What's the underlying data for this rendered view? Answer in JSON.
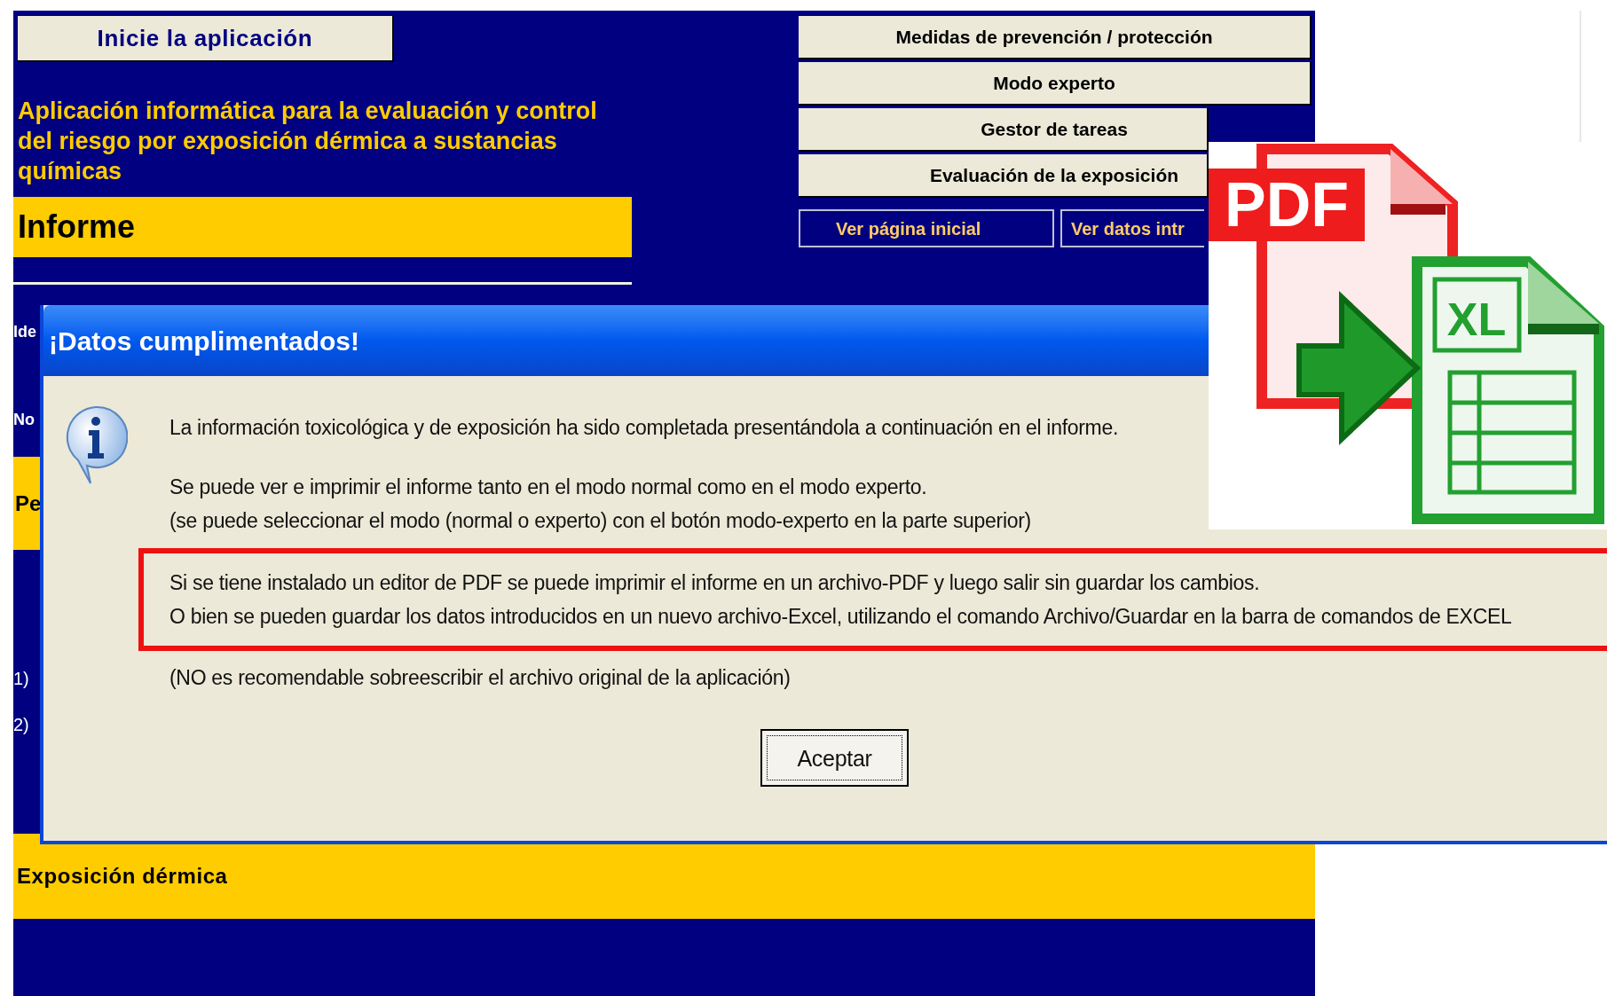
{
  "sheet": {
    "start_button": "Inicie la aplicación",
    "app_title": "Aplicación informática para la evaluación y control  del riesgo por exposición dérmica a sustancias químicas",
    "section_title": "Informe",
    "menu_buttons": [
      "Medidas de prevención / protección",
      "Modo experto",
      "Gestor de tareas",
      "Evaluación de la exposición"
    ],
    "nav_links": [
      "Ver página inicial",
      "Ver datos intr"
    ],
    "partial_labels": [
      "Ide",
      "No",
      "Pe",
      "1)",
      "2)"
    ],
    "footer_band": "Exposición dérmica"
  },
  "dialog": {
    "title": "¡Datos cumplimentados!",
    "message": "La información toxicológica y de exposición ha sido completada presentándola a continuación en el informe.",
    "view_lines": [
      "Se puede ver e imprimir el informe tanto en el modo normal como en el modo experto.",
      "(se puede seleccionar el modo (normal o experto) con el botón modo-experto en la parte superior)"
    ],
    "highlighted_lines": [
      "Si se tiene instalado un editor de PDF se puede imprimir el informe en un archivo-PDF y luego salir sin guardar los cambios.",
      "O bien se pueden guardar los datos introducidos en un nuevo archivo-Excel, utilizando el comando Archivo/Guardar en la barra de comandos de EXCEL"
    ],
    "note": "(NO es recomendable sobreescribir el archivo original de la aplicación)",
    "button": "Aceptar"
  },
  "logo": {
    "pdf_label": "PDF",
    "xl_label": "XL"
  }
}
